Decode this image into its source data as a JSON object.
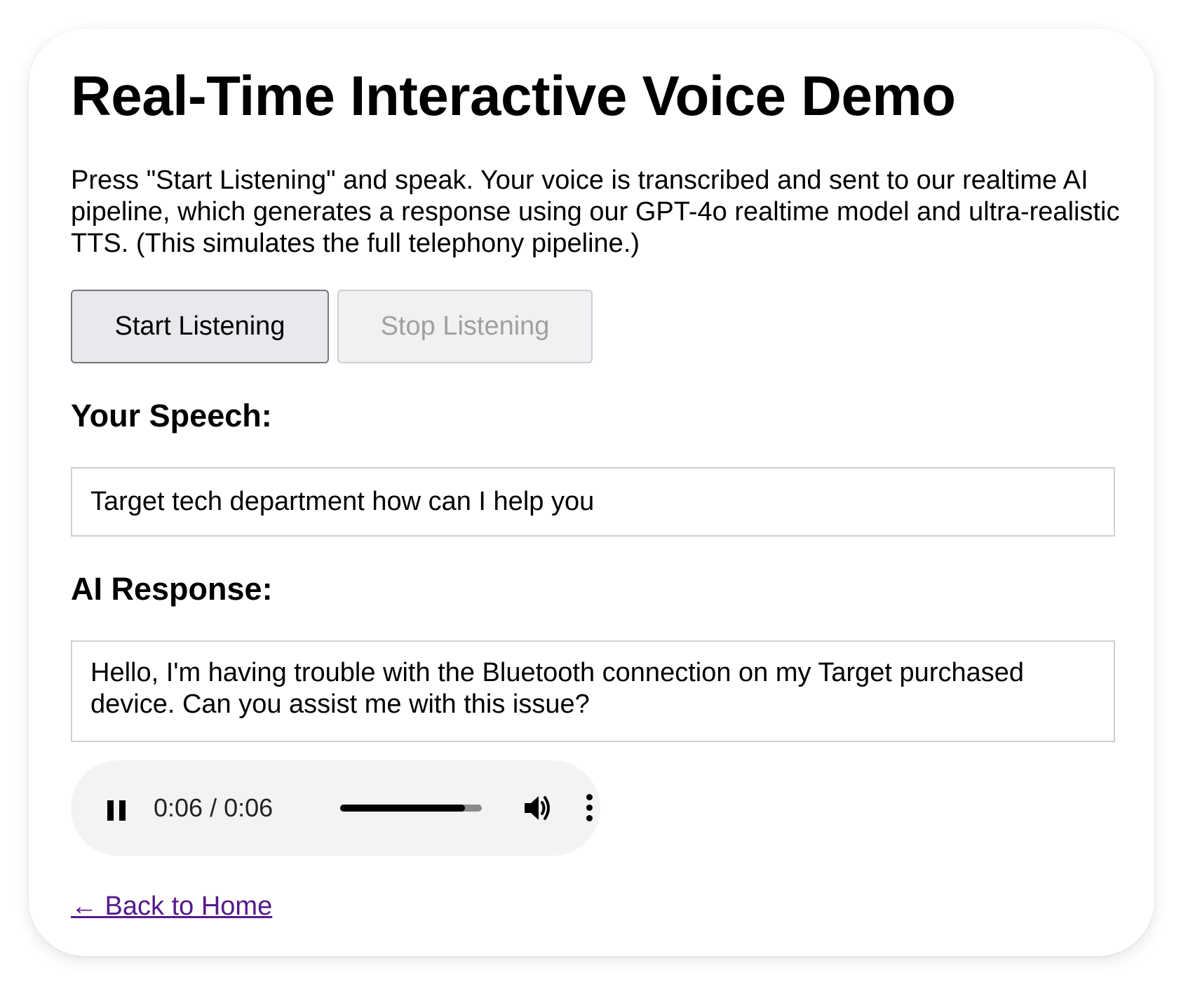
{
  "page": {
    "title": "Real-Time Interactive Voice Demo",
    "description": "Press \"Start Listening\" and speak. Your voice is transcribed and sent to our realtime AI pipeline, which generates a response using our GPT-4o realtime model and ultra-realistic TTS. (This simulates the full telephony pipeline.)"
  },
  "buttons": {
    "start_label": "Start Listening",
    "stop_label": "Stop Listening",
    "stop_disabled": true
  },
  "speech": {
    "heading": "Your Speech:",
    "text": "Target tech department how can I help you"
  },
  "response": {
    "heading": "AI Response:",
    "text": "Hello, I'm having trouble with the Bluetooth connection on my Target purchased device. Can you assist me with this issue?"
  },
  "audio_player": {
    "time_display": "0:06 / 0:06",
    "progress_fraction": 0.88,
    "state": "playing",
    "icons": [
      "pause-icon",
      "volume-icon",
      "more-options-icon"
    ]
  },
  "nav": {
    "back_link": "← Back to Home"
  },
  "colors": {
    "link": "#551a8b",
    "player_bg": "#f1f3f4"
  }
}
